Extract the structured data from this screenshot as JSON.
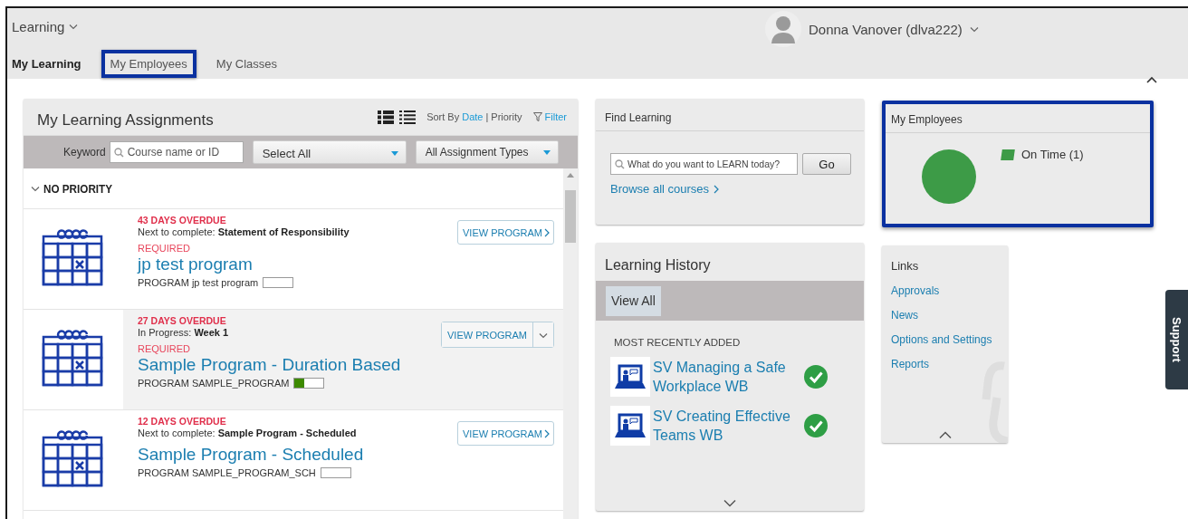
{
  "app": {
    "title": "Learning",
    "user": "Donna Vanover (dlva222)"
  },
  "tabs": [
    {
      "label": "My Learning",
      "selected": true,
      "highlighted": false
    },
    {
      "label": "My Employees",
      "selected": false,
      "highlighted": true
    },
    {
      "label": "My Classes",
      "selected": false,
      "highlighted": false
    }
  ],
  "assignments": {
    "title": "My Learning Assignments",
    "sort_label": "Sort By",
    "sort_options": [
      {
        "label": "Date",
        "selected": true
      },
      {
        "label": "Priority",
        "selected": false
      }
    ],
    "sort_separator": "|",
    "filter": "Filter",
    "keyword_label": "Keyword",
    "keyword_placeholder": "Course name or ID",
    "status_select": "Select All",
    "type_select": "All Assignment Types",
    "group": {
      "label": "NO PRIORITY",
      "expanded": true
    },
    "items": [
      {
        "status": "43 DAYS OVERDUE",
        "detail_label": "Next to complete:",
        "detail_value": "Statement of Responsibility",
        "required": "REQUIRED",
        "title": "jp test program",
        "code": "PROGRAM jp test program",
        "level": 0,
        "button": "VIEW PROGRAM",
        "kind": "link",
        "selected": false
      },
      {
        "status": "27 DAYS OVERDUE",
        "detail_label": "In Progress:",
        "detail_value": "Week 1",
        "required": "REQUIRED",
        "title": "Sample Program - Duration Based",
        "code": "PROGRAM SAMPLE_PROGRAM",
        "level": 0.33,
        "button": "VIEW PROGRAM",
        "kind": "split",
        "selected": true
      },
      {
        "status": "12 DAYS OVERDUE",
        "detail_label": "Next to complete:",
        "detail_value": "Sample Program - Scheduled",
        "title": "Sample Program - Scheduled",
        "code": "PROGRAM SAMPLE_PROGRAM_SCH",
        "level": 0,
        "button": "VIEW PROGRAM",
        "kind": "link",
        "selected": false
      }
    ]
  },
  "find_learning": {
    "title": "Find Learning",
    "placeholder": "What do you want to LEARN today?",
    "button": "Go",
    "link": "Browse all courses"
  },
  "history": {
    "title": "Learning History",
    "button": "View All",
    "subtitle": "MOST RECENTLY ADDED",
    "items": [
      {
        "title": "SV Managing a Safe Workplace WB",
        "completed": true
      },
      {
        "title": "SV Creating Effective Teams WB",
        "completed": true
      }
    ]
  },
  "employees": {
    "title": "My Employees",
    "highlighted": true,
    "legend": [
      {
        "label": "On Time (1)",
        "color": "#3d9b47"
      }
    ]
  },
  "links": {
    "title": "Links",
    "items": [
      "Approvals",
      "News",
      "Options and Settings",
      "Reports"
    ]
  },
  "support": "Support"
}
